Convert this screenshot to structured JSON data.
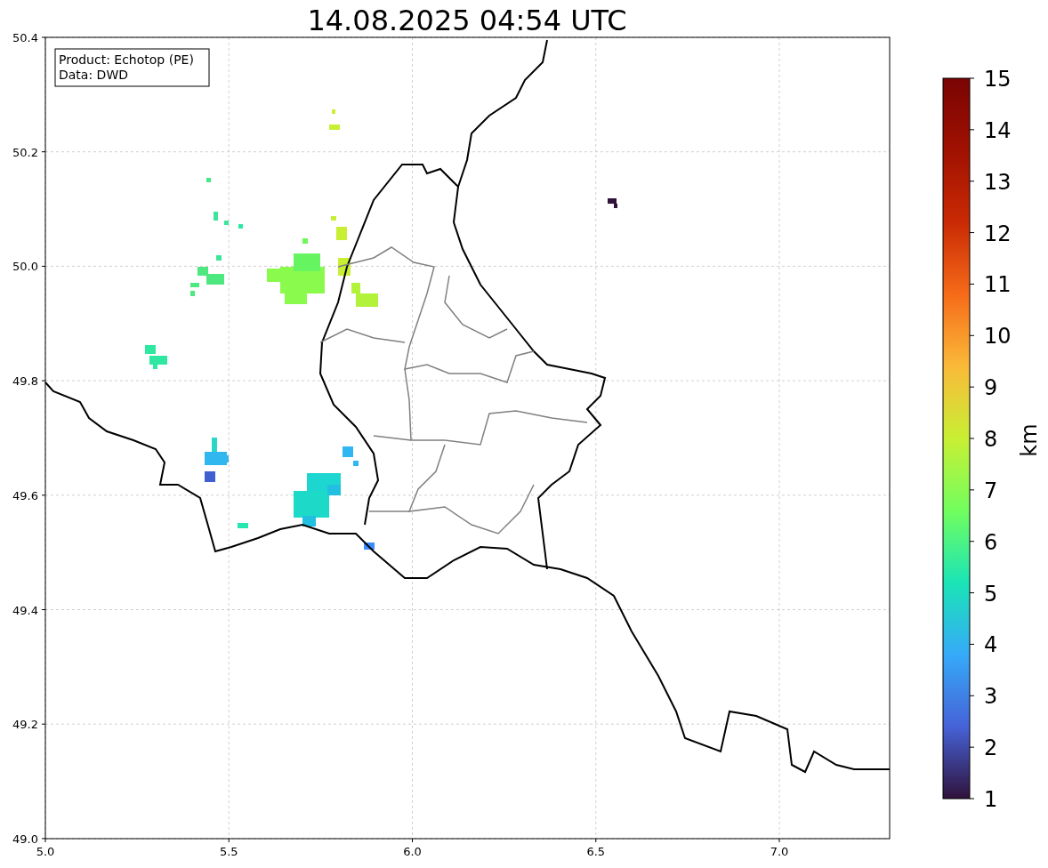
{
  "title": "14.08.2025 04:54 UTC",
  "info_box": [
    "Product: Echotop (PE)",
    "Data: DWD"
  ],
  "x_ticks": [
    "5.0",
    "5.5",
    "6.0",
    "6.5",
    "7.0"
  ],
  "y_ticks": [
    "50.4",
    "50.2",
    "50.0",
    "49.8",
    "49.6",
    "49.4",
    "49.2",
    "49.0"
  ],
  "colorbar": {
    "label": "km",
    "ticks": [
      "15",
      "14",
      "13",
      "12",
      "11",
      "10",
      "9",
      "8",
      "7",
      "6",
      "5",
      "4",
      "3",
      "2",
      "1"
    ]
  }
}
